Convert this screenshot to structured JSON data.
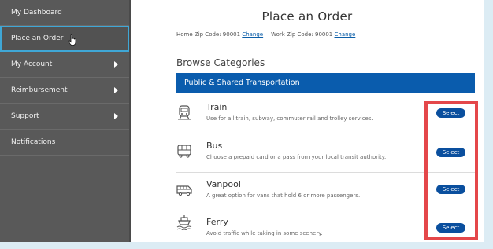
{
  "sidebar": {
    "items": [
      {
        "label": "My Dashboard",
        "has_submenu": false,
        "active": false
      },
      {
        "label": "Place an Order",
        "has_submenu": false,
        "active": true
      },
      {
        "label": "My Account",
        "has_submenu": true,
        "active": false
      },
      {
        "label": "Reimbursement",
        "has_submenu": true,
        "active": false
      },
      {
        "label": "Support",
        "has_submenu": true,
        "active": false
      },
      {
        "label": "Notifications",
        "has_submenu": false,
        "active": false
      }
    ]
  },
  "header": {
    "title": "Place an Order",
    "home_zip_label": "Home Zip Code: 90001",
    "work_zip_label": "Work Zip Code: 90001",
    "change_link": "Change"
  },
  "browse": {
    "title": "Browse Categories",
    "category": "Public & Shared Transportation",
    "items": [
      {
        "name": "Train",
        "description": "Use for all train, subway, commuter rail and trolley services.",
        "button": "Select",
        "icon": "train-icon"
      },
      {
        "name": "Bus",
        "description": "Choose a prepaid card or a pass from your local transit authority.",
        "button": "Select",
        "icon": "bus-icon"
      },
      {
        "name": "Vanpool",
        "description": "A great option for vans that hold 6 or more passengers.",
        "button": "Select",
        "icon": "van-icon"
      },
      {
        "name": "Ferry",
        "description": "Avoid traffic while taking in some scenery.",
        "button": "Select",
        "icon": "ferry-icon"
      }
    ]
  },
  "colors": {
    "sidebar_bg": "#595959",
    "accent_blue": "#0a5cad",
    "active_border": "#3fa7d6",
    "highlight_red": "#e4474a"
  }
}
